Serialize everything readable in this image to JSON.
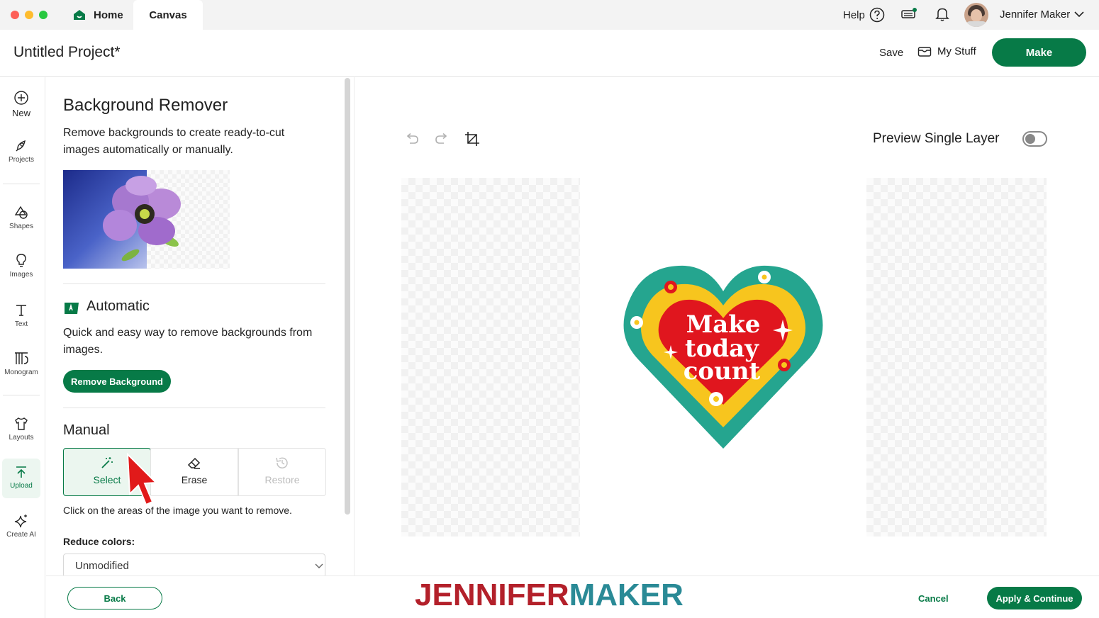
{
  "window": {
    "tabs": {
      "home": "Home",
      "canvas": "Canvas"
    }
  },
  "topbar": {
    "help": "Help",
    "user_name": "Jennifer Maker"
  },
  "project": {
    "title": "Untitled Project*",
    "save": "Save",
    "my_stuff": "My Stuff",
    "make": "Make"
  },
  "rail": {
    "new": "New",
    "projects": "Projects",
    "shapes": "Shapes",
    "images": "Images",
    "text": "Text",
    "monogram": "Monogram",
    "layouts": "Layouts",
    "upload": "Upload",
    "create_ai": "Create AI"
  },
  "panel": {
    "title": "Background Remover",
    "description": "Remove backgrounds to create ready-to-cut images automatically or manually.",
    "automatic": {
      "heading": "Automatic",
      "description": "Quick and easy way to remove backgrounds from images.",
      "button": "Remove Background"
    },
    "manual": {
      "heading": "Manual",
      "tools": {
        "select": "Select",
        "erase": "Erase",
        "restore": "Restore"
      },
      "hint": "Click on the areas of the image you want to remove.",
      "reduce_colors_label": "Reduce colors:",
      "reduce_colors_value": "Unmodified"
    }
  },
  "canvas": {
    "preview_label": "Preview Single Layer",
    "preview_enabled": false,
    "design_text": {
      "line1": "Make",
      "line2": "today",
      "line3": "count"
    }
  },
  "footer": {
    "back": "Back",
    "cancel": "Cancel",
    "apply": "Apply & Continue",
    "watermark_part1": "JENNIFER",
    "watermark_part2": "MAKER"
  },
  "colors": {
    "accent": "#077a47",
    "heart_teal": "#25a58f",
    "heart_yellow": "#f7c51e",
    "heart_red": "#e0161e",
    "watermark_red": "#b3202a",
    "watermark_teal": "#2a8a96"
  }
}
